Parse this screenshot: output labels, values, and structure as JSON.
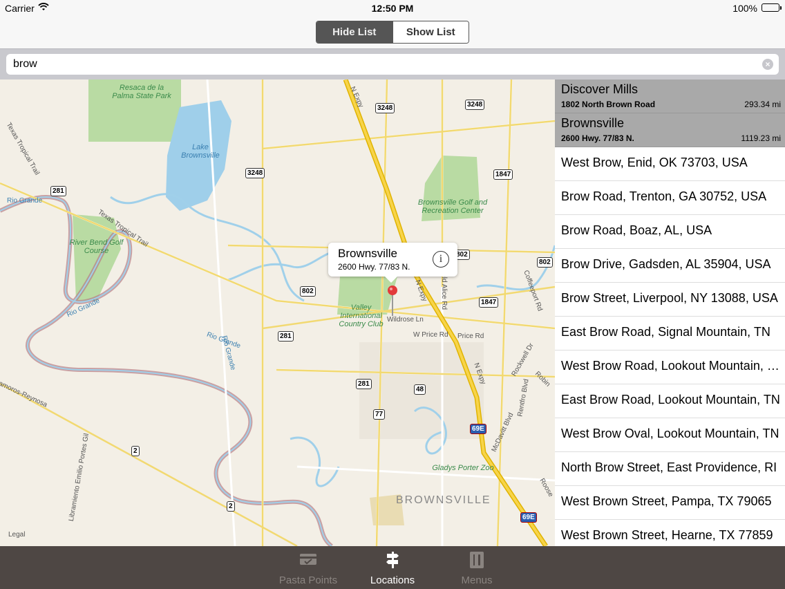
{
  "status_bar": {
    "carrier": "Carrier",
    "time": "12:50 PM",
    "battery": "100%"
  },
  "segmented": {
    "hide_list": "Hide List",
    "show_list": "Show List"
  },
  "search": {
    "value": "brow"
  },
  "map": {
    "callout_title": "Brownsville",
    "callout_subtitle": "2600 Hwy. 77/83 N.",
    "legal": "Legal",
    "city_label": "BROWNSVILLE",
    "labels": {
      "resaca": "Resaca de la Palma State Park",
      "lake": "Lake Brownsville",
      "river_bend": "River Bend Golf Course",
      "brownsville_golf": "Brownsville Golf and Recreation Center",
      "valley": "Valley International Country Club",
      "zoo": "Gladys Porter Zoo"
    },
    "streets": {
      "texas_tropical": "Texas Tropical Trail",
      "texas_tropical_2": "Texas Tropical Trail",
      "rio_grande_1": "Rio Grande",
      "rio_grande_2": "Rio Grande",
      "rio_grande_3": "Rio Grande",
      "rio_grande_4": "Rio Grande",
      "n_expy_1": "N Expy",
      "n_expy_2": "N Expy",
      "n_expy_3": "N Expy",
      "wildrose": "Wildrose Ln",
      "w_price": "W Price Rd",
      "price": "Price Rd",
      "old_alice": "Old Alice Rd",
      "coffeeport": "Coffeeport Rd",
      "rockwell": "Rockwell Dr",
      "rentfro": "Rentfro Blvd",
      "mcdavitt": "McDavitt Blvd",
      "matamoros": "amoros-Reynosa",
      "libramiento": "Libramiento Emilio Portes Gil",
      "robin": "Robin",
      "roose": "Roose"
    },
    "shields": [
      "3248",
      "3248",
      "3248",
      "281",
      "1847",
      "802",
      "802",
      "802",
      "1847",
      "281",
      "281",
      "48",
      "77",
      "69E",
      "69E",
      "2",
      "2"
    ]
  },
  "results": [
    {
      "title": "Discover Mills",
      "address": "1802 North Brown Road",
      "distance": "293.34 mi"
    },
    {
      "title": "Brownsville",
      "address": "2600 Hwy. 77/83 N.",
      "distance": "1119.23 mi"
    },
    {
      "title": "West Brow, Enid, OK 73703, USA"
    },
    {
      "title": "Brow Road, Trenton, GA 30752, USA"
    },
    {
      "title": "Brow Road, Boaz, AL, USA"
    },
    {
      "title": "Brow Drive, Gadsden, AL 35904, USA"
    },
    {
      "title": "Brow Street, Liverpool, NY 13088, USA"
    },
    {
      "title": "East Brow Road, Signal Mountain, TN"
    },
    {
      "title": "West Brow Road, Lookout Mountain, GA"
    },
    {
      "title": "East Brow Road, Lookout Mountain, TN"
    },
    {
      "title": "West Brow Oval, Lookout Mountain, TN"
    },
    {
      "title": "North Brow Street, East Providence, RI"
    },
    {
      "title": "West Brown Street, Pampa, TX 79065"
    },
    {
      "title": "West Brown Street, Hearne, TX 77859"
    }
  ],
  "tabs": {
    "pasta_points": "Pasta Points",
    "locations": "Locations",
    "menus": "Menus"
  }
}
